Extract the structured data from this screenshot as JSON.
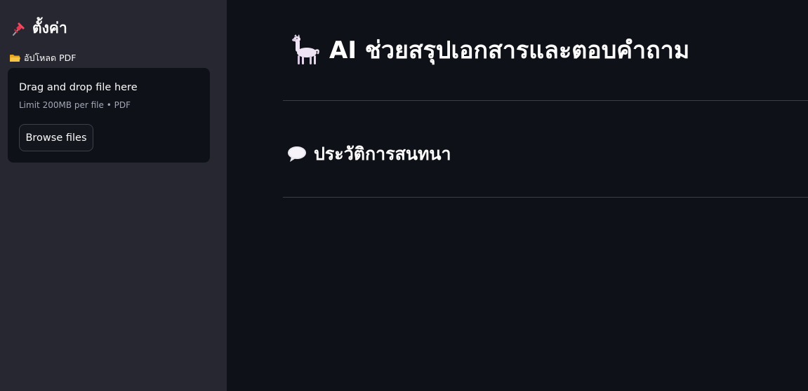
{
  "sidebar": {
    "title": "ตั้งค่า",
    "title_icon": "pushpin-icon",
    "upload_label": "อัปโหลด PDF",
    "upload_icon": "folder-icon",
    "dropzone": {
      "title": "Drag and drop file here",
      "limit": "Limit 200MB per file • PDF",
      "browse_label": "Browse files"
    }
  },
  "main": {
    "title": "AI ช่วยสรุปเอกสารและตอบคำถาม",
    "title_icon": "llama-icon",
    "chat_heading": "ประวัติการสนทนา",
    "chat_heading_icon": "speech-balloon-icon"
  },
  "colors": {
    "main_bg": "#0e1117",
    "sidebar_bg": "#262730",
    "dropzone_bg": "#0e1117",
    "text": "#fafafa",
    "muted_text": "#a3a8b8",
    "divider": "#3b3e47"
  }
}
